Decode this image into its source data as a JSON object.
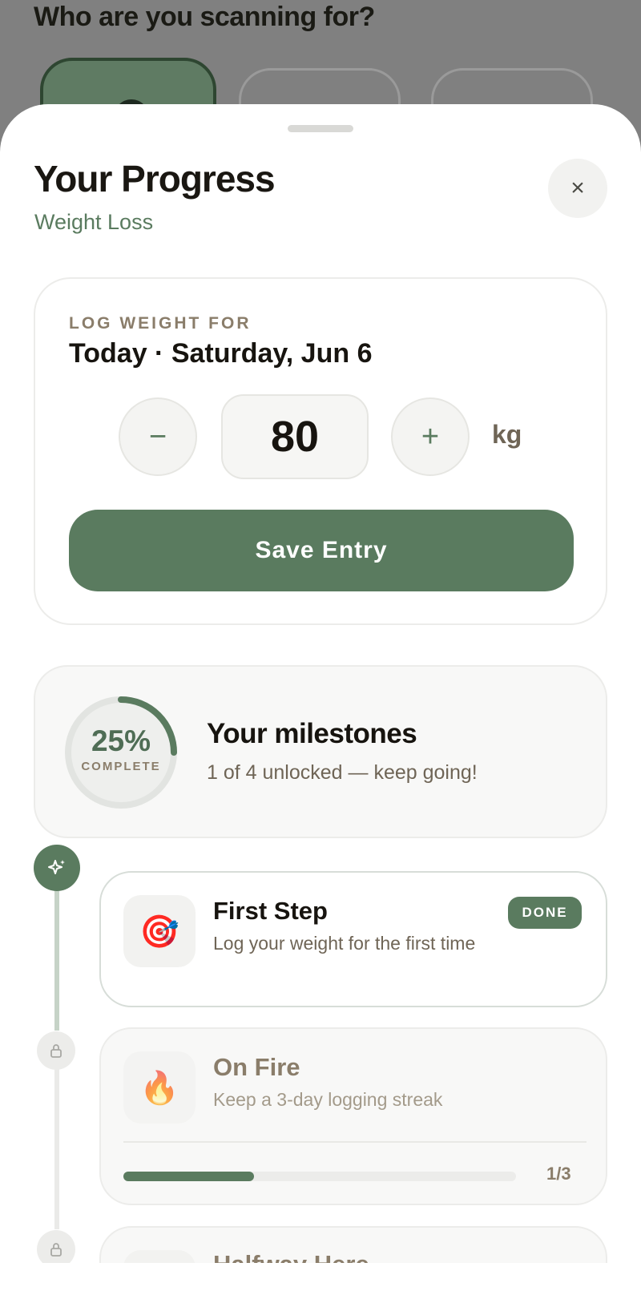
{
  "background": {
    "title": "Who are you scanning for?"
  },
  "sheet": {
    "title": "Your Progress",
    "subtitle": "Weight Loss",
    "close_icon": "×"
  },
  "log": {
    "label": "LOG WEIGHT FOR",
    "date": "Today · Saturday, Jun 6",
    "minus": "−",
    "plus": "+",
    "weight": "80",
    "unit": "kg",
    "save_label": "Save Entry"
  },
  "milestones_summary": {
    "percent": "25%",
    "percent_value": 25,
    "complete_label": "COMPLETE",
    "title": "Your milestones",
    "subtitle": "1 of 4 unlocked — keep going!"
  },
  "milestones": [
    {
      "icon": "🎯",
      "title": "First Step",
      "description": "Log your weight for the first time",
      "badge": "DONE"
    },
    {
      "icon": "🔥",
      "title": "On Fire",
      "description": "Keep a 3-day logging streak",
      "progress_text": "1/3",
      "progress": 0.333
    },
    {
      "title": "Halfway Here"
    }
  ],
  "colors": {
    "accent": "#5a7b5f",
    "text": "#17140f",
    "muted": "#8a7d6a"
  }
}
